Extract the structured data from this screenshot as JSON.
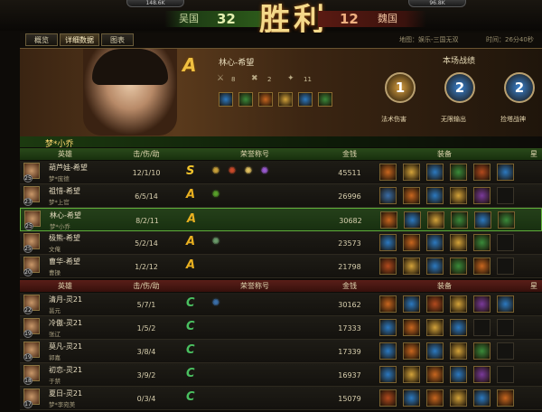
{
  "banner": {
    "left_stat": "148.6K",
    "right_stat": "96.8K",
    "left_team": "吴国",
    "left_score": "32",
    "victory": "胜利",
    "right_score": "12",
    "right_team": "魏国"
  },
  "tabs": [
    {
      "label": "概览",
      "active": false
    },
    {
      "label": "详细数据",
      "active": true
    },
    {
      "label": "图表",
      "active": false
    }
  ],
  "map_info": "地图：娱乐-三国无双",
  "time_info": "时间：26分40秒",
  "hero_header": {
    "grade": "A",
    "hero": "林心-希望",
    "kills": "8",
    "deaths": "2",
    "assists": "11",
    "player_name": "梦*小乔",
    "battle_title": "本场战绩",
    "medals": [
      {
        "rank": "1",
        "label": "法术伤害",
        "color": "#d9a040"
      },
      {
        "rank": "2",
        "label": "无限输出",
        "color": "#3a82d0"
      },
      {
        "rank": "2",
        "label": "捡塔战神",
        "color": "#3a82d0"
      }
    ]
  },
  "table": {
    "headers": {
      "hero": "英雄",
      "kda": "击/伤/助",
      "honor": "荣誉称号",
      "gold": "金钱",
      "equip": "装备",
      "extra": "星"
    },
    "team_a": [
      {
        "hero": "葫芦娃-希望",
        "player": "梦*庞德",
        "level": "25",
        "kda": "12/1/10",
        "grade": "S",
        "gold": "45511",
        "honors": [
          "#c9a13a",
          "#c94a2a",
          "#e0c060",
          "#9a5ad0"
        ],
        "items": [
          "#c8661f",
          "#d3a23a",
          "#2c79c0",
          "#3a8a3a",
          "#b34a1e",
          "#2c79c0"
        ]
      },
      {
        "hero": "祖惜-希望",
        "player": "梦*上官",
        "level": "23",
        "kda": "6/5/14",
        "grade": "A",
        "gold": "26996",
        "honors": [
          "#58a02a"
        ],
        "items": [
          "#3a6ea8",
          "#c8661f",
          "#2c79c0",
          "#d3a23a",
          "#7a3a9a",
          ""
        ]
      },
      {
        "hero": "林心-希望",
        "player": "梦*小乔",
        "level": "25",
        "kda": "8/2/11",
        "grade": "A",
        "gold": "30682",
        "honors": [],
        "items": [
          "#c8661f",
          "#2c79c0",
          "#d3a23a",
          "#3a8a3a",
          "#2c79c0",
          "#3a8a3a"
        ],
        "highlight": true
      },
      {
        "hero": "极熊-希望",
        "player": "文俺",
        "level": "25",
        "kda": "5/2/14",
        "grade": "A",
        "gold": "23573",
        "honors": [
          "#6a9a6a"
        ],
        "items": [
          "#2c79c0",
          "#c8661f",
          "#2c79c0",
          "#d3a23a",
          "#3a8a3a",
          ""
        ]
      },
      {
        "hero": "曹华-希望",
        "player": "曹操",
        "level": "20",
        "kda": "1/2/12",
        "grade": "A",
        "gold": "21798",
        "honors": [],
        "items": [
          "#b34a1e",
          "#d3a23a",
          "#2c79c0",
          "#3a8a3a",
          "#c8661f",
          ""
        ]
      }
    ],
    "team_b": [
      {
        "hero": "清月-灵21",
        "player": "邕元",
        "level": "22",
        "kda": "5/7/1",
        "grade": "C",
        "gold": "30162",
        "honors": [
          "#3a6ea8"
        ],
        "items": [
          "#c8661f",
          "#2c79c0",
          "#b34a1e",
          "#d3a23a",
          "#7a3a9a",
          "#2c79c0"
        ]
      },
      {
        "hero": "冷傲-灵21",
        "player": "张辽",
        "level": "19",
        "kda": "1/5/2",
        "grade": "C",
        "gold": "17333",
        "honors": [],
        "items": [
          "#2c79c0",
          "#c8661f",
          "#d3a23a",
          "#2c79c0",
          "",
          ""
        ]
      },
      {
        "hero": "莫凡-灵21",
        "player": "郭嘉",
        "level": "19",
        "kda": "3/8/4",
        "grade": "C",
        "gold": "17339",
        "honors": [],
        "items": [
          "#2c79c0",
          "#c8661f",
          "#2c79c0",
          "#d3a23a",
          "#3a8a3a",
          ""
        ]
      },
      {
        "hero": "初恋-灵21",
        "player": "于禁",
        "level": "18",
        "kda": "3/9/2",
        "grade": "C",
        "gold": "16937",
        "honors": [],
        "items": [
          "#2c79c0",
          "#d3a23a",
          "#c8661f",
          "#2c79c0",
          "#7a3a9a",
          ""
        ]
      },
      {
        "hero": "夏日-灵21",
        "player": "梦*李宛美",
        "level": "17",
        "kda": "0/3/4",
        "grade": "C",
        "gold": "15079",
        "honors": [],
        "items": [
          "#b34a1e",
          "#2c79c0",
          "#c8661f",
          "#d3a23a",
          "#2c79c0",
          "#c8661f"
        ]
      }
    ]
  },
  "colors": {
    "grade_S": "#f4c52c",
    "grade_A": "#e8b020",
    "grade_C": "#4ac060"
  }
}
